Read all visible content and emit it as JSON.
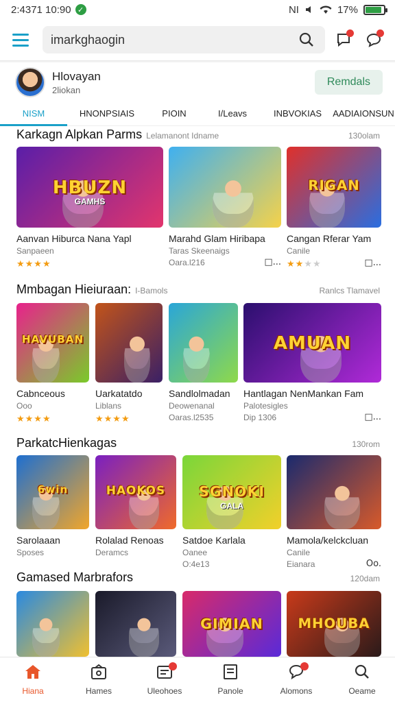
{
  "status_bar": {
    "time": "2:4371 10:90",
    "signal": "NI",
    "battery": "17%",
    "battery_level": 0.9
  },
  "header": {
    "search_value": "imarkghaogin"
  },
  "profile": {
    "name": "Hlovayan",
    "subtitle": "2liokan",
    "button_label": "Remdals"
  },
  "tabs": [
    "NISM",
    "HNONPSIAIS",
    "PIOIN",
    "I/Leavs",
    "INBVOKIAS",
    "AADIAIONSUN"
  ],
  "sections": [
    {
      "title": "Karkagn Alpkan Parms",
      "subtitle": "Lelamanont  Idname",
      "more": "130olam",
      "cards": [
        {
          "name": "Aanvan Hiburca Nana Yapl",
          "meta": "Sanpaeen",
          "rating": 3.5,
          "more": "",
          "thumb_title": "HBUZN",
          "thumb_sub": "GAMHS",
          "colors": [
            "#5a1ea8",
            "#e2356d"
          ]
        },
        {
          "name": "Marahd Glam Hiribapa",
          "meta": "Taras Skeenaigs",
          "meta2": "Oara.l216",
          "rating": 0,
          "more": "□...",
          "thumb_title": "",
          "thumb_sub": "",
          "colors": [
            "#3fb0f0",
            "#f5d24a"
          ]
        },
        {
          "name": "Cangan Rferar Yam",
          "meta": "Canile",
          "rating": 2,
          "more": "□...",
          "thumb_title": "RIGAN",
          "thumb_sub": "",
          "colors": [
            "#e0302a",
            "#2a6ee0"
          ]
        }
      ]
    },
    {
      "title": "Mmbagan Hieiuraan:",
      "subtitle": "I-Bamols",
      "more": "Ranlcs Tlamavel",
      "cards": [
        {
          "name": "Cabnceous",
          "meta": "Ooo",
          "rating": 3.5,
          "more": "",
          "thumb_title": "HAVUBAN",
          "thumb_sub": "",
          "colors": [
            "#e8218c",
            "#7acb2a"
          ]
        },
        {
          "name": "Uarkatatdo",
          "meta": "Liblans",
          "rating": 3.5,
          "more": "",
          "thumb_title": "",
          "thumb_sub": "",
          "colors": [
            "#c2541a",
            "#3a2066"
          ]
        },
        {
          "name": "Sandlolmadan",
          "meta": "Deowenanal",
          "meta2": "Oaras.l2535",
          "rating": 0,
          "more": "",
          "thumb_title": "",
          "thumb_sub": "",
          "colors": [
            "#2aa6d8",
            "#8fd94a"
          ]
        },
        {
          "name": "Hantlagan NenMankan Fam",
          "meta": "Palotesigles",
          "meta2": "Dip 1306",
          "rating": 0,
          "more": "□...",
          "thumb_title": "AMUAN",
          "thumb_sub": "",
          "colors": [
            "#2b0f6e",
            "#b02ad8"
          ]
        }
      ]
    },
    {
      "title": "ParkatcHienkagas",
      "subtitle": "",
      "more": "130rom",
      "cards": [
        {
          "name": "Sarolaaan",
          "meta": "Sposes",
          "rating": 0,
          "more": "",
          "thumb_title": "6win",
          "thumb_sub": "",
          "colors": [
            "#1e6fd0",
            "#f2a62a"
          ]
        },
        {
          "name": "Rolalad Renoas",
          "meta": "Deramcs",
          "rating": 0,
          "more": "",
          "thumb_title": "HAOKOS",
          "thumb_sub": "",
          "colors": [
            "#7a20c0",
            "#f06a2a"
          ]
        },
        {
          "name": "Satdoe Karlala",
          "meta": "Oanee",
          "meta2": "O:4e13",
          "rating": 0,
          "more": "",
          "thumb_title": "SGNOKI",
          "thumb_sub": "GALA",
          "colors": [
            "#7ad63a",
            "#f2d02a"
          ]
        },
        {
          "name": "Mamola/kelckcluan",
          "meta": "Canile",
          "meta2": "Eianara",
          "rating": 0,
          "more": "Oo.",
          "thumb_title": "",
          "thumb_sub": "",
          "colors": [
            "#1a2a6e",
            "#d85a2a"
          ]
        }
      ]
    },
    {
      "title": "Gamased Marbrafors",
      "subtitle": "",
      "more": "120dam",
      "cards": [
        {
          "thumb_title": "",
          "colors": [
            "#2a8ae0",
            "#f0c030"
          ]
        },
        {
          "thumb_title": "",
          "colors": [
            "#1a1a2a",
            "#5a5a7a"
          ]
        },
        {
          "thumb_title": "GIMIAN",
          "colors": [
            "#d82a6a",
            "#5a2ad8"
          ]
        },
        {
          "thumb_title": "MHOUBA",
          "colors": [
            "#c83a1a",
            "#2a1a1a"
          ]
        }
      ]
    }
  ],
  "bottom_nav": [
    {
      "label": "Hiana",
      "icon": "home-icon",
      "badge": false
    },
    {
      "label": "Hames",
      "icon": "games-icon",
      "badge": false
    },
    {
      "label": "Uleohoes",
      "icon": "inbox-icon",
      "badge": true
    },
    {
      "label": "Panole",
      "icon": "document-icon",
      "badge": false
    },
    {
      "label": "Alomons",
      "icon": "chat-icon",
      "badge": true
    },
    {
      "label": "Oeame",
      "icon": "search-icon",
      "badge": false
    }
  ],
  "colors": {
    "accent": "#1aa0c8",
    "active_nav": "#e8562a",
    "star": "#f39c12",
    "pill_bg": "#e7f1ec",
    "pill_text": "#2f8a5a"
  }
}
